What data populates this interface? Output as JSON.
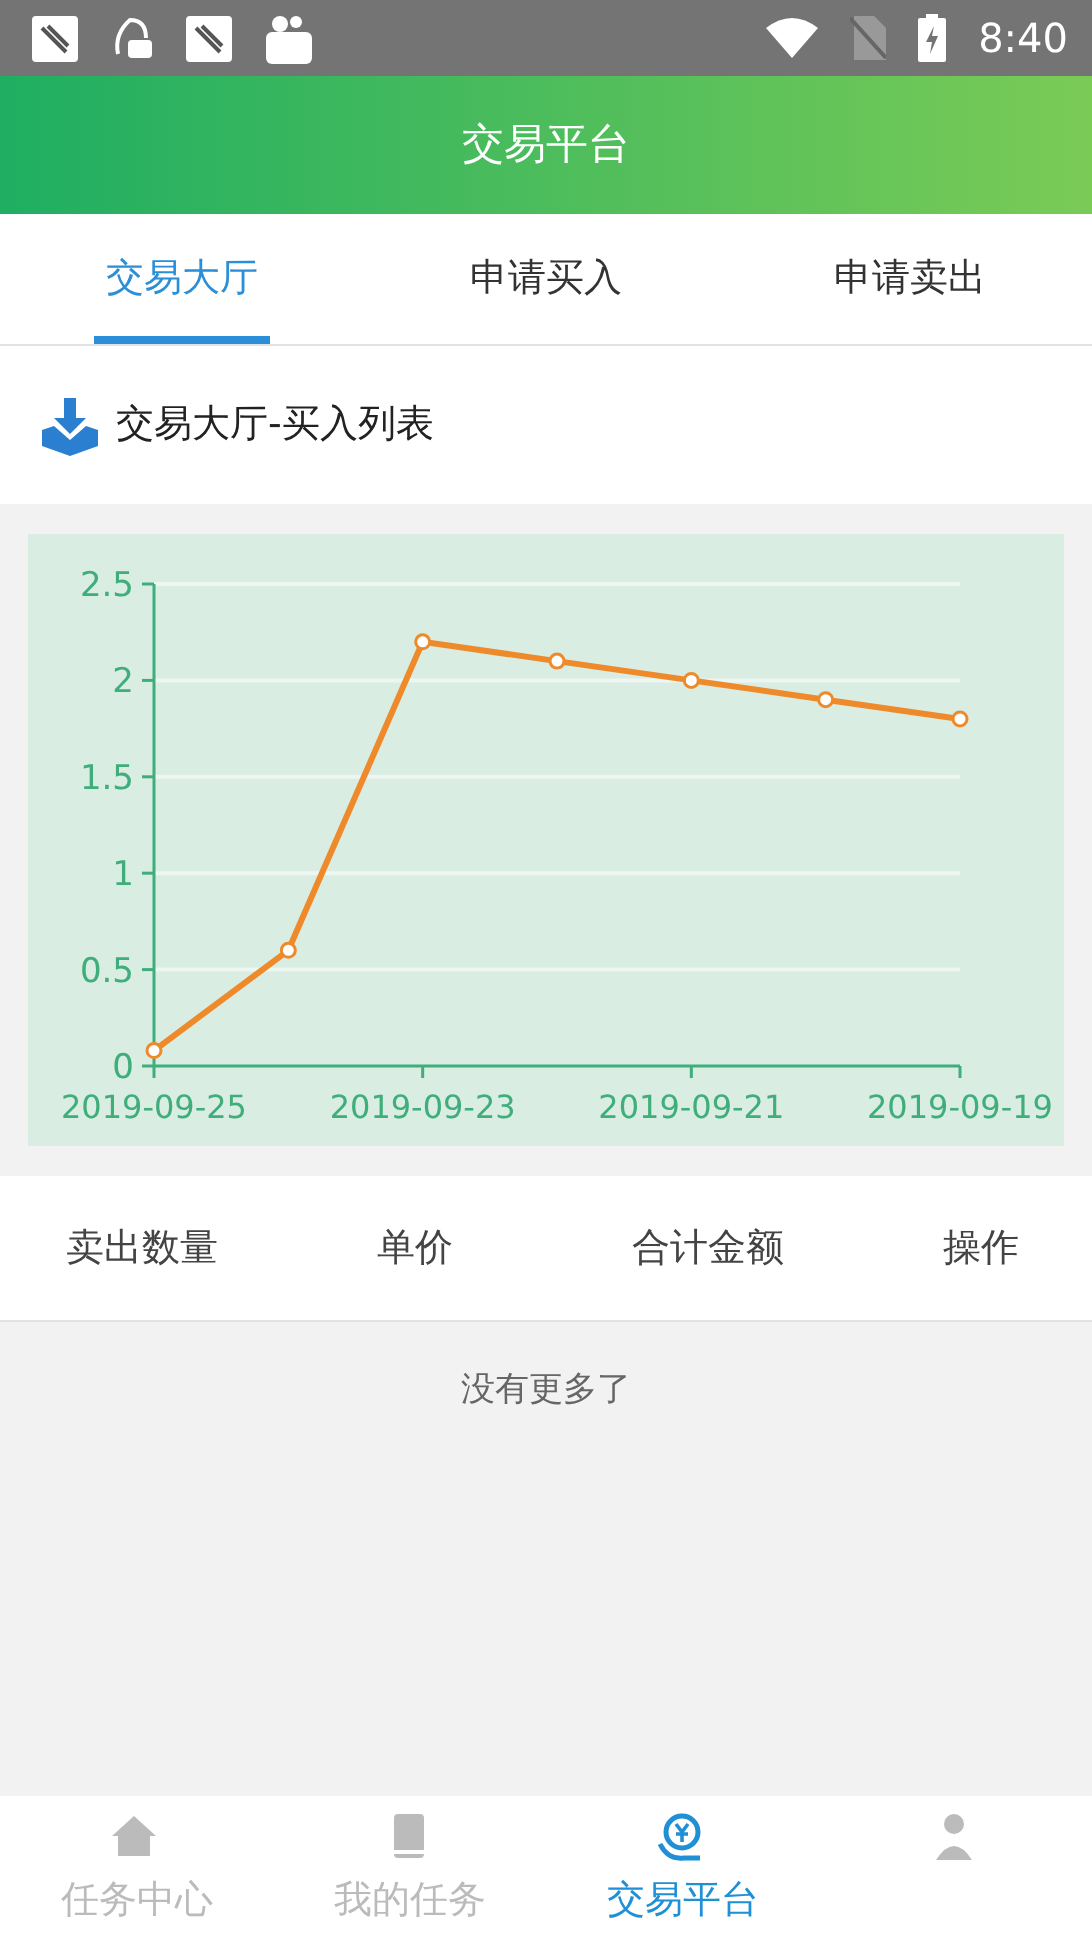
{
  "status_bar": {
    "time": "8:40"
  },
  "header": {
    "title": "交易平台"
  },
  "tabs": [
    {
      "label": "交易大厅",
      "selected": true
    },
    {
      "label": "申请买入",
      "selected": false
    },
    {
      "label": "申请卖出",
      "selected": false
    }
  ],
  "section": {
    "title": "交易大厅-买入列表"
  },
  "chart": {
    "chart_data": {
      "type": "line",
      "categories": [
        "2019-09-25",
        null,
        "2019-09-23",
        null,
        "2019-09-21",
        null,
        "2019-09-19"
      ],
      "grid": true,
      "series": [
        {
          "color": "#ef8a2b",
          "marker": true,
          "values": [
            0.08,
            0.6,
            2.2,
            2.1,
            2.0,
            1.9,
            1.8
          ]
        }
      ],
      "ylim": [
        0,
        2.5
      ],
      "yticks": [
        0,
        {
          "value": 0.5,
          "label": "0.5"
        },
        1,
        {
          "value": 1.5,
          "label": "1.5"
        },
        2,
        {
          "value": 2.5,
          "label": "2.5"
        }
      ]
    }
  },
  "table": {
    "columns": [
      "卖出数量",
      "单价",
      "合计金额",
      "操作"
    ]
  },
  "empty_text": "没有更多了",
  "bottom_nav": [
    {
      "label": "任务中心",
      "selected": false
    },
    {
      "label": "我的任务",
      "selected": false
    },
    {
      "label": "交易平台",
      "selected": true
    },
    {
      "selected": false
    }
  ]
}
